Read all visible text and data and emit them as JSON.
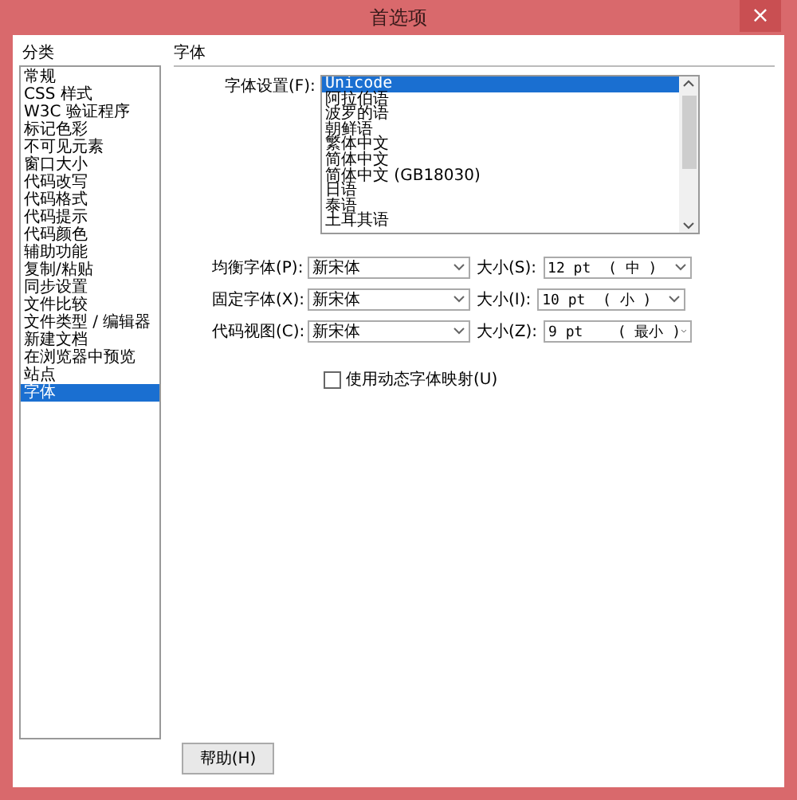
{
  "window": {
    "title": "首选项",
    "close": "×"
  },
  "sidebar": {
    "heading": "分类",
    "items": [
      {
        "label": "常规",
        "selected": false
      },
      {
        "label": "CSS 样式",
        "selected": false
      },
      {
        "label": "W3C 验证程序",
        "selected": false
      },
      {
        "label": "标记色彩",
        "selected": false
      },
      {
        "label": "不可见元素",
        "selected": false
      },
      {
        "label": "窗口大小",
        "selected": false
      },
      {
        "label": "代码改写",
        "selected": false
      },
      {
        "label": "代码格式",
        "selected": false
      },
      {
        "label": "代码提示",
        "selected": false
      },
      {
        "label": "代码颜色",
        "selected": false
      },
      {
        "label": "辅助功能",
        "selected": false
      },
      {
        "label": "复制/粘贴",
        "selected": false
      },
      {
        "label": "同步设置",
        "selected": false
      },
      {
        "label": "文件比较",
        "selected": false
      },
      {
        "label": "文件类型 / 编辑器",
        "selected": false
      },
      {
        "label": "新建文档",
        "selected": false
      },
      {
        "label": "在浏览器中预览",
        "selected": false
      },
      {
        "label": "站点",
        "selected": false
      },
      {
        "label": "字体",
        "selected": true
      }
    ]
  },
  "panel": {
    "heading": "字体",
    "encoding": {
      "label": "字体设置(F):",
      "items": [
        {
          "label": "Unicode",
          "selected": true
        },
        {
          "label": "阿拉伯语",
          "selected": false
        },
        {
          "label": "波罗的语",
          "selected": false
        },
        {
          "label": "朝鲜语",
          "selected": false
        },
        {
          "label": "繁体中文",
          "selected": false
        },
        {
          "label": "简体中文",
          "selected": false
        },
        {
          "label": "简体中文 (GB18030)",
          "selected": false
        },
        {
          "label": "日语",
          "selected": false
        },
        {
          "label": "泰语",
          "selected": false
        },
        {
          "label": "土耳其语",
          "selected": false
        }
      ]
    },
    "fonts": [
      {
        "label": "均衡字体(P):",
        "font": "新宋体",
        "size_label": "大小(S):",
        "size": "12 pt  ( 中 )"
      },
      {
        "label": "固定字体(X):",
        "font": "新宋体",
        "size_label": "大小(I):",
        "size": "10 pt  ( 小 )"
      },
      {
        "label": "代码视图(C):",
        "font": "新宋体",
        "size_label": "大小(Z):",
        "size": "9 pt    ( 最小 )"
      }
    ],
    "dynamic_mapping": {
      "label": "使用动态字体映射(U)",
      "checked": false
    }
  },
  "buttons": [
    "帮助(H)"
  ]
}
